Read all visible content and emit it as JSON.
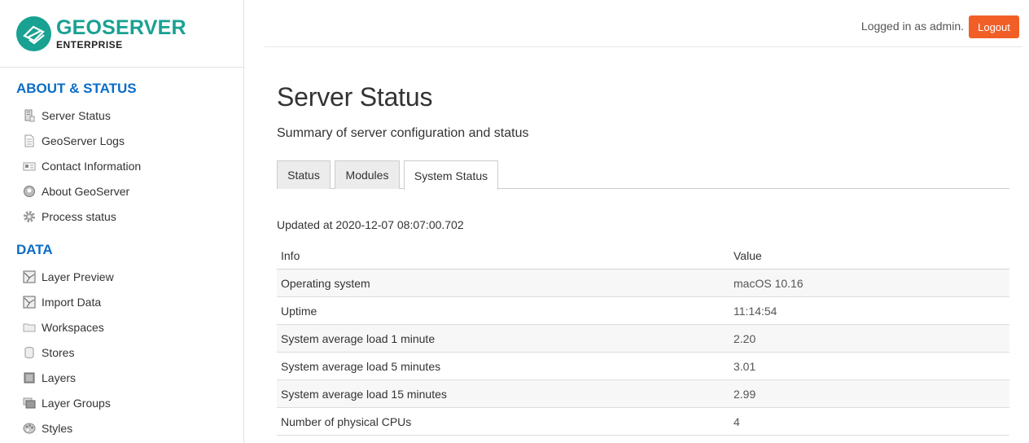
{
  "logo": {
    "main": "GEOSERVER",
    "sub": "ENTERPRISE"
  },
  "sidebar": {
    "sections": [
      {
        "title": "ABOUT & STATUS",
        "items": [
          {
            "label": "Server Status",
            "icon": "server-icon"
          },
          {
            "label": "GeoServer Logs",
            "icon": "document-icon"
          },
          {
            "label": "Contact Information",
            "icon": "contact-card-icon"
          },
          {
            "label": "About GeoServer",
            "icon": "info-icon"
          },
          {
            "label": "Process status",
            "icon": "gear-icon"
          }
        ]
      },
      {
        "title": "DATA",
        "items": [
          {
            "label": "Layer Preview",
            "icon": "map-icon"
          },
          {
            "label": "Import Data",
            "icon": "map-import-icon"
          },
          {
            "label": "Workspaces",
            "icon": "folder-icon"
          },
          {
            "label": "Stores",
            "icon": "database-icon"
          },
          {
            "label": "Layers",
            "icon": "layer-icon"
          },
          {
            "label": "Layer Groups",
            "icon": "layer-group-icon"
          },
          {
            "label": "Styles",
            "icon": "palette-icon"
          }
        ]
      }
    ]
  },
  "header": {
    "login_text": "Logged in as admin.",
    "logout_label": "Logout",
    "logout_color": "#f25f26"
  },
  "page": {
    "title": "Server Status",
    "subtitle": "Summary of server configuration and status",
    "tabs": [
      {
        "label": "Status",
        "active": false
      },
      {
        "label": "Modules",
        "active": false
      },
      {
        "label": "System Status",
        "active": true
      }
    ],
    "updated": "Updated at 2020-12-07 08:07:00.702"
  },
  "table": {
    "columns": [
      "Info",
      "Value"
    ],
    "rows": [
      [
        "Operating system",
        "macOS 10.16"
      ],
      [
        "Uptime",
        "11:14:54"
      ],
      [
        "System average load 1 minute",
        "2.20"
      ],
      [
        "System average load 5 minutes",
        "3.01"
      ],
      [
        "System average load 15 minutes",
        "2.99"
      ],
      [
        "Number of physical CPUs",
        "4"
      ]
    ]
  },
  "colors": {
    "brand": "#19a192",
    "section": "#0b6dc7"
  }
}
